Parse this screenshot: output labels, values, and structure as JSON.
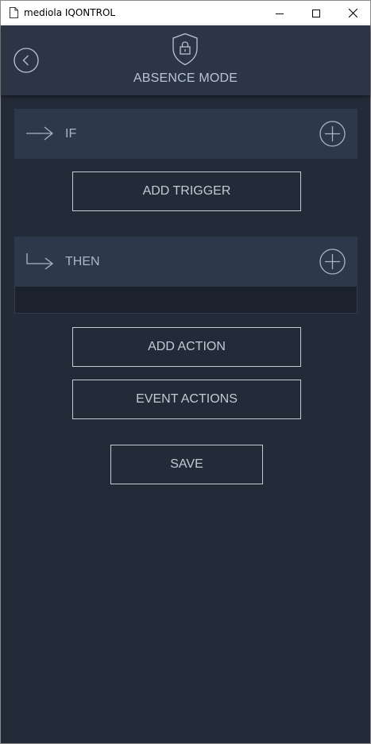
{
  "window": {
    "title": "mediola IQONTROL",
    "icons": {
      "document": "document-icon",
      "minimize": "minimize-icon",
      "maximize": "maximize-icon",
      "close": "close-icon"
    }
  },
  "header": {
    "title": "ABSENCE MODE",
    "icons": {
      "back": "chevron-left-circle-icon",
      "mode": "shield-lock-icon"
    }
  },
  "if_section": {
    "label": "IF",
    "icons": {
      "arrow": "arrow-right-icon",
      "add": "plus-circle-icon"
    }
  },
  "add_trigger_label": "ADD TRIGGER",
  "then_section": {
    "label": "THEN",
    "icons": {
      "arrow": "arrow-turn-right-icon",
      "add": "plus-circle-icon"
    }
  },
  "add_action_label": "ADD ACTION",
  "event_actions_label": "EVENT ACTIONS",
  "save_label": "SAVE",
  "colors": {
    "background": "#232b38",
    "header": "#2b3546",
    "section": "#2d384a",
    "text": "#b9c3d1"
  }
}
